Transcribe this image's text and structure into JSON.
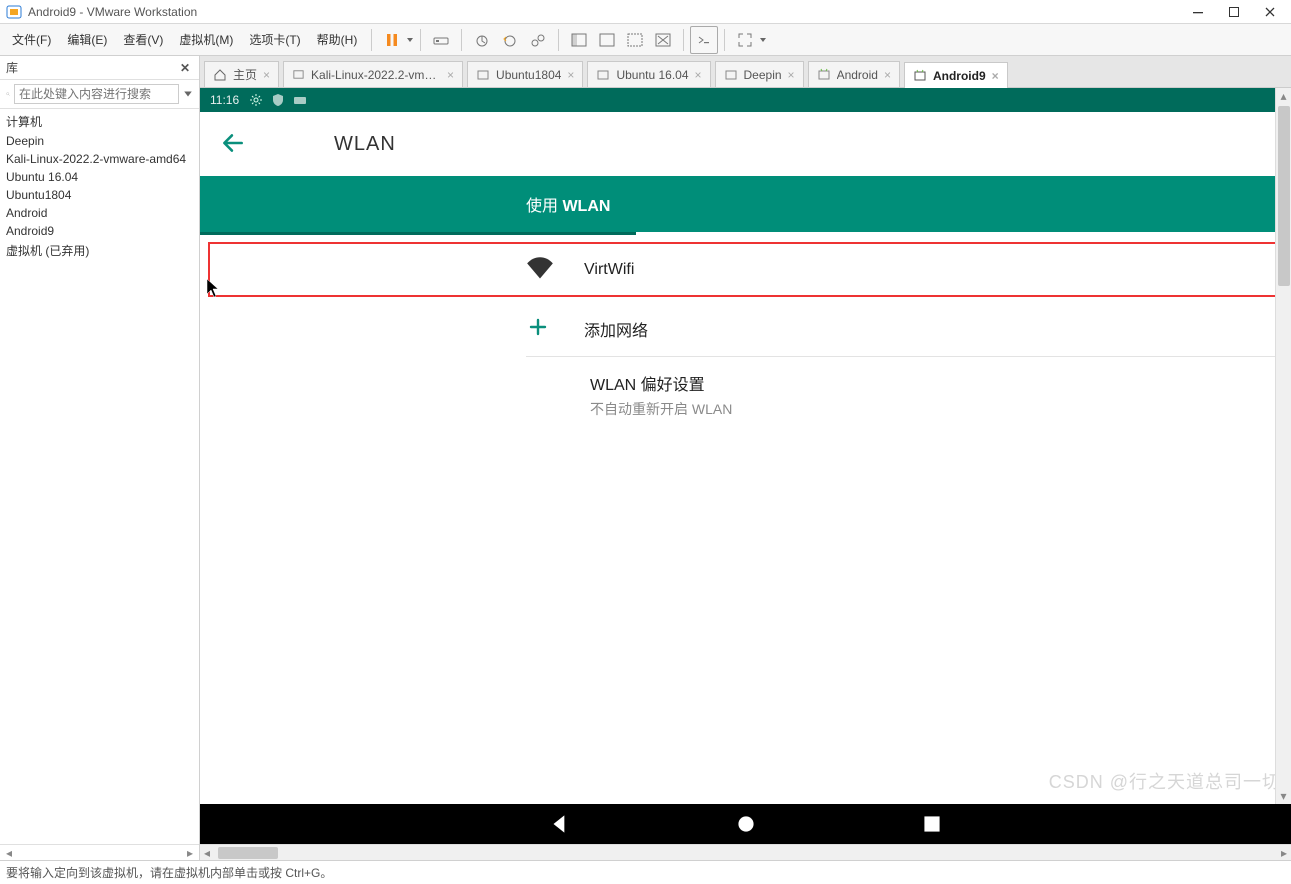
{
  "window": {
    "title": "Android9 - VMware Workstation"
  },
  "menu": {
    "file": "文件(F)",
    "edit": "编辑(E)",
    "view": "查看(V)",
    "vm": "虚拟机(M)",
    "tabs": "选项卡(T)",
    "help": "帮助(H)"
  },
  "sidebar": {
    "title": "库",
    "search_placeholder": "在此处键入内容进行搜索",
    "items": [
      "计算机",
      "Deepin",
      "Kali-Linux-2022.2-vmware-amd64",
      "Ubuntu 16.04",
      "Ubuntu1804",
      "Android",
      "Android9",
      "虚拟机 (已弃用)"
    ]
  },
  "tabs": [
    {
      "label": "主页",
      "home": true,
      "active": false
    },
    {
      "label": "Kali-Linux-2022.2-vmware-am...",
      "active": false
    },
    {
      "label": "Ubuntu1804",
      "active": false
    },
    {
      "label": "Ubuntu 16.04",
      "active": false
    },
    {
      "label": "Deepin",
      "active": false
    },
    {
      "label": "Android",
      "active": false
    },
    {
      "label": "Android9",
      "active": true
    }
  ],
  "android": {
    "time": "11:16",
    "title": "WLAN",
    "banner_prefix": "使用 ",
    "banner_bold": "WLAN",
    "wifi_name": "VirtWifi",
    "add_network": "添加网络",
    "pref_title": "WLAN 偏好设置",
    "pref_sub": "不自动重新开启 WLAN"
  },
  "status": "要将输入定向到该虚拟机，请在虚拟机内部单击或按 Ctrl+G。",
  "watermark": "CSDN @行之天道总司一切"
}
